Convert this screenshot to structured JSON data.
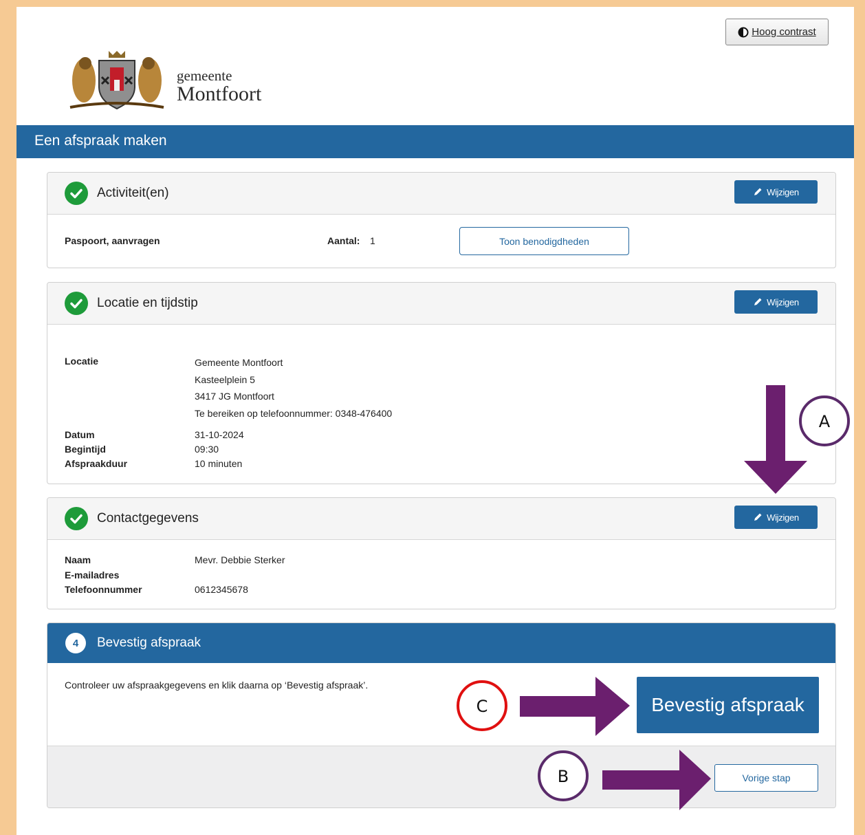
{
  "header": {
    "contrast_label": "Hoog contrast",
    "logo_small": "gemeente",
    "logo_big": "Montfoort",
    "page_title": "Een afspraak maken"
  },
  "edit_label": "Wijzigen",
  "activity": {
    "title": "Activiteit(en)",
    "name": "Paspoort, aanvragen",
    "count_label": "Aantal:",
    "count_value": "1",
    "show_button": "Toon benodigdheden"
  },
  "location": {
    "title": "Locatie en tijdstip",
    "location_label": "Locatie",
    "address_lines": [
      "Gemeente Montfoort",
      "Kasteelplein 5",
      "3417 JG Montfoort",
      "Te bereiken op telefoonnummer: 0348-476400"
    ],
    "date_label": "Datum",
    "date_value": "31-10-2024",
    "start_label": "Begintijd",
    "start_value": "09:30",
    "duration_label": "Afspraakduur",
    "duration_value": "10 minuten"
  },
  "contact": {
    "title": "Contactgegevens",
    "name_label": "Naam",
    "name_value": "Mevr. Debbie Sterker",
    "email_label": "E-mailadres",
    "email_value": "",
    "phone_label": "Telefoonnummer",
    "phone_value": "0612345678"
  },
  "confirm": {
    "step": "4",
    "title": "Bevestig afspraak",
    "instruction": "Controleer uw afspraakgegevens en klik daarna op ‘Bevestig afspraak’.",
    "confirm_button": "Bevestig afspraak",
    "back_button": "Vorige stap"
  },
  "annotations": {
    "a": "A",
    "b": "B",
    "c": "C",
    "arrow_color": "#6b1f6e",
    "circle_purple": "#5a2a6a",
    "circle_red": "#e01010"
  },
  "colors": {
    "frame": "#f6ca94",
    "primary": "#23679f",
    "success": "#1e9b3a"
  }
}
